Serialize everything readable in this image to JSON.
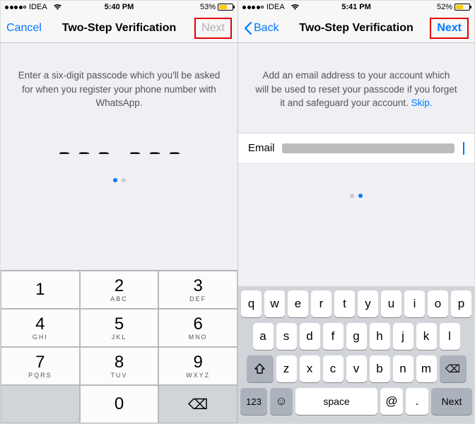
{
  "left": {
    "status": {
      "carrier": "IDEA",
      "time": "5:40 PM",
      "battery_pct": "53%"
    },
    "nav": {
      "left": "Cancel",
      "title": "Two-Step Verification",
      "right": "Next"
    },
    "instruction": "Enter a six-digit passcode which you'll be asked for when you register your phone number with WhatsApp.",
    "passcode_dashes": [
      "–",
      "–",
      "–",
      "–",
      "–",
      "–"
    ],
    "pager_active": 0,
    "numpad": {
      "keys": [
        {
          "n": "1",
          "l": ""
        },
        {
          "n": "2",
          "l": "ABC"
        },
        {
          "n": "3",
          "l": "DEF"
        },
        {
          "n": "4",
          "l": "GHI"
        },
        {
          "n": "5",
          "l": "JKL"
        },
        {
          "n": "6",
          "l": "MNO"
        },
        {
          "n": "7",
          "l": "PQRS"
        },
        {
          "n": "8",
          "l": "TUV"
        },
        {
          "n": "9",
          "l": "WXYZ"
        },
        {
          "n": "",
          "l": ""
        },
        {
          "n": "0",
          "l": ""
        },
        {
          "n": "⌫",
          "l": ""
        }
      ]
    }
  },
  "right": {
    "status": {
      "carrier": "IDEA",
      "time": "5:41 PM",
      "battery_pct": "52%"
    },
    "nav": {
      "left": "Back",
      "title": "Two-Step Verification",
      "right": "Next"
    },
    "instruction_pre": "Add an email address to your account which will be used to reset your passcode if you forget it and safeguard your account. ",
    "instruction_link": "Skip.",
    "email_label": "Email",
    "pager_active": 1,
    "keyboard": {
      "row1": [
        "q",
        "w",
        "e",
        "r",
        "t",
        "y",
        "u",
        "i",
        "o",
        "p"
      ],
      "row2": [
        "a",
        "s",
        "d",
        "f",
        "g",
        "h",
        "j",
        "k",
        "l"
      ],
      "row3": [
        "z",
        "x",
        "c",
        "v",
        "b",
        "n",
        "m"
      ],
      "switch": "123",
      "space": "space",
      "at": "@",
      "dot": ".",
      "next": "Next"
    }
  }
}
